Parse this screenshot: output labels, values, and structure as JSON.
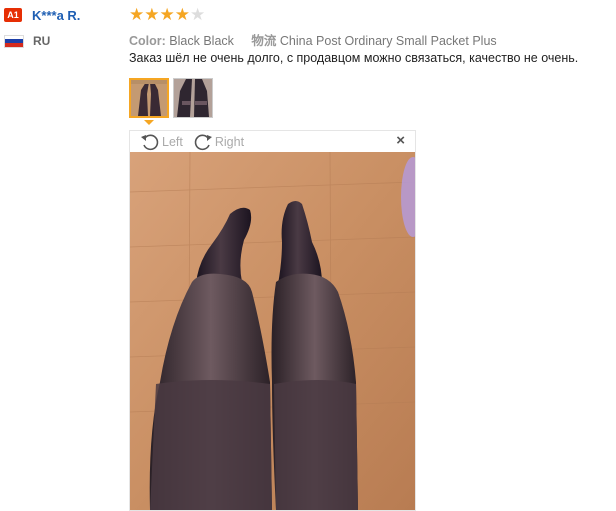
{
  "user": {
    "level": "A1",
    "name": "K***a R.",
    "country": "RU"
  },
  "review": {
    "rating": 4,
    "max_rating": 5,
    "color_label": "Color:",
    "color_value": "Black Black",
    "shipping_label": "物流",
    "shipping_value": "China Post Ordinary Small Packet Plus",
    "feedback": "Заказ шёл не очень долго, с продавцом можно связаться, качество не очень."
  },
  "viewer": {
    "rotate_left_label": "Left",
    "rotate_right_label": "Right",
    "close_label": "×"
  },
  "icons": {
    "rotate_left": "rotate-left-icon",
    "rotate_right": "rotate-right-icon",
    "close": "close-icon"
  },
  "colors": {
    "badge": "#e62e04",
    "username": "#1f5fb3",
    "star_on": "#f5a623",
    "star_off": "#dddddd"
  }
}
